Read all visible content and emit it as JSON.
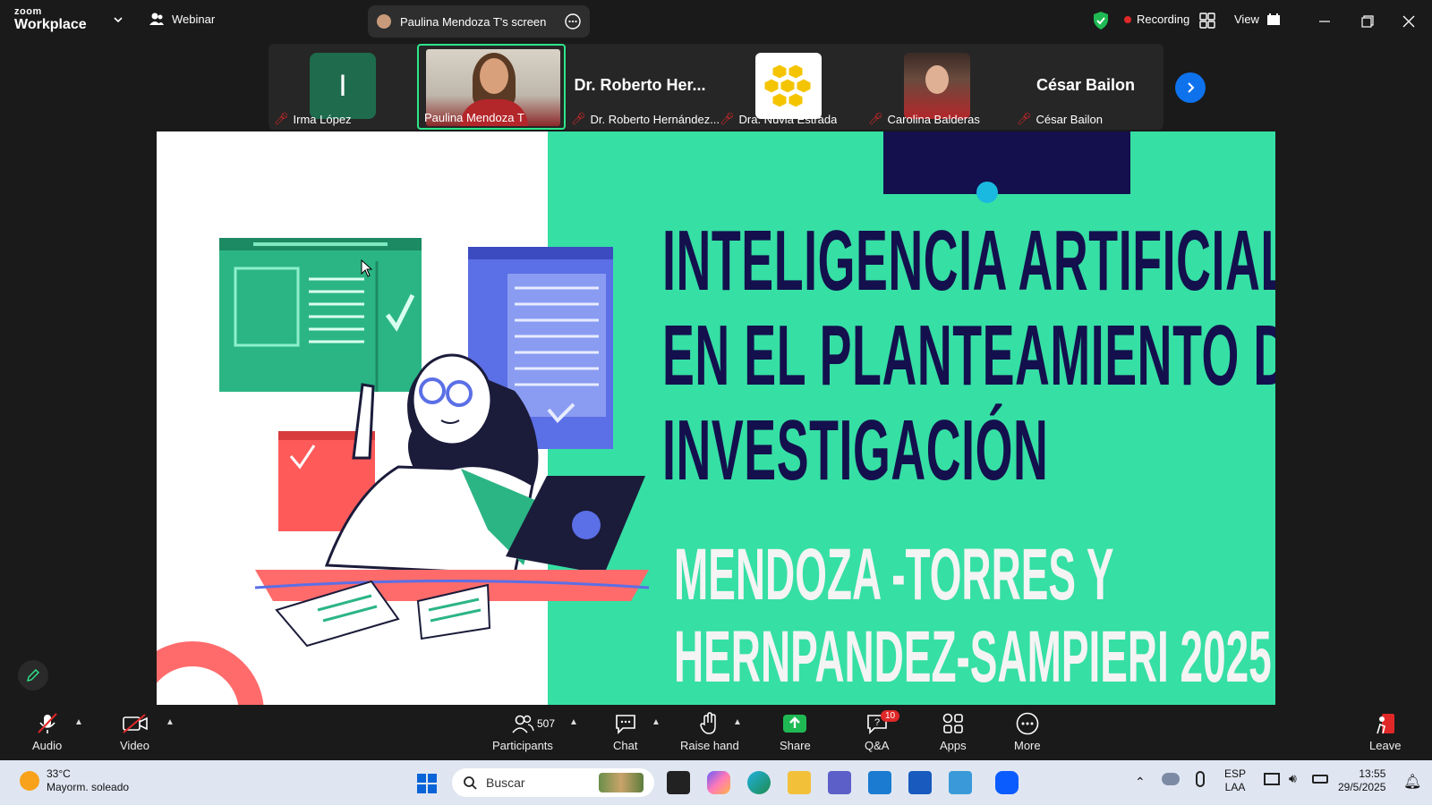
{
  "titlebar": {
    "brand_top": "zoom",
    "brand_bottom": "Workplace",
    "webinar_label": "Webinar",
    "screen_label": "Paulina Mendoza T's screen",
    "recording_label": "Recording",
    "view_label": "View"
  },
  "gallery": [
    {
      "name": "Irma López",
      "initial": "I",
      "muted": true
    },
    {
      "name": "Paulina Mendoza T",
      "muted": true,
      "active": true
    },
    {
      "name": "Dr. Roberto Hernández...",
      "big_name": "Dr. Roberto Her...",
      "muted": true
    },
    {
      "name": "Dra. Nuvia Estrada",
      "muted": true
    },
    {
      "name": "Carolina Balderas",
      "muted": true
    },
    {
      "name": "César Bailon",
      "big_name": "César Bailon",
      "muted": true
    }
  ],
  "slide": {
    "title_lines": [
      "INTELIGENCIA ARTIFICIAL",
      "EN EL PLANTEAMIENTO DE",
      "INVESTIGACIÓN"
    ],
    "author_lines": [
      "MENDOZA -TORRES Y",
      "HERNPANDEZ-SAMPIERI 2025"
    ],
    "colors": {
      "green": "#36dfa4",
      "navy": "#13104d",
      "coral": "#ff6b6b",
      "blue": "#5b6fe6"
    }
  },
  "toolbar": {
    "audio": "Audio",
    "video": "Video",
    "participants": "Participants",
    "participants_count": "507",
    "chat": "Chat",
    "raise_hand": "Raise hand",
    "share": "Share",
    "qa": "Q&A",
    "qa_badge": "10",
    "apps": "Apps",
    "more": "More",
    "leave": "Leave"
  },
  "taskbar": {
    "temp": "33°C",
    "weather": "Mayorm. soleado",
    "search_placeholder": "Buscar",
    "lang_top": "ESP",
    "lang_bottom": "LAA",
    "time": "13:55",
    "date": "29/5/2025"
  }
}
